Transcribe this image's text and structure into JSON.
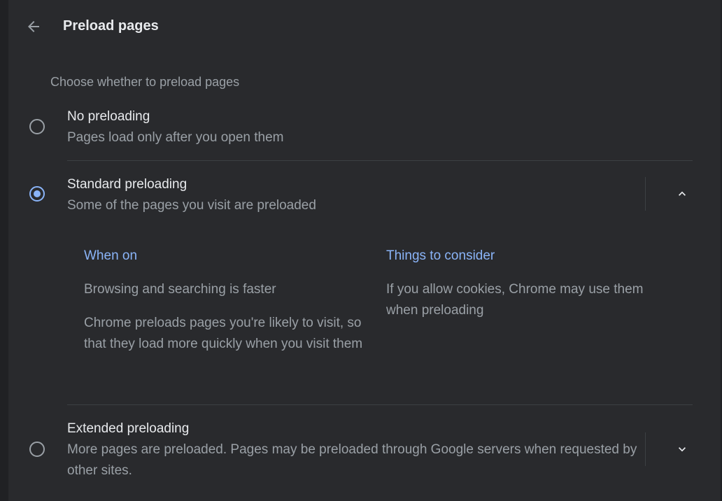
{
  "header": {
    "back_icon": "arrow-left-icon",
    "title": "Preload pages"
  },
  "section": {
    "label": "Choose whether to preload pages"
  },
  "options": [
    {
      "title": "No preloading",
      "description": "Pages load only after you open them",
      "selected": false
    },
    {
      "title": "Standard preloading",
      "description": "Some of the pages you visit are preloaded",
      "selected": true,
      "expanded": true,
      "expand_icon": "chevron-up-icon",
      "details": {
        "when_on": {
          "heading": "When on",
          "points": [
            "Browsing and searching is faster",
            "Chrome preloads pages you're likely to visit, so that they load more quickly when you visit them"
          ]
        },
        "things_to_consider": {
          "heading": "Things to consider",
          "points": [
            "If you allow cookies, Chrome may use them when preloading"
          ]
        }
      }
    },
    {
      "title": "Extended preloading",
      "description": "More pages are preloaded. Pages may be preloaded through Google servers when requested by other sites.",
      "selected": false,
      "expanded": false,
      "expand_icon": "chevron-down-icon"
    }
  ],
  "colors": {
    "background": "#292a2d",
    "text_primary": "#e8eaed",
    "text_secondary": "#9aa0a6",
    "accent": "#8ab4f8",
    "divider": "#3c4043"
  }
}
